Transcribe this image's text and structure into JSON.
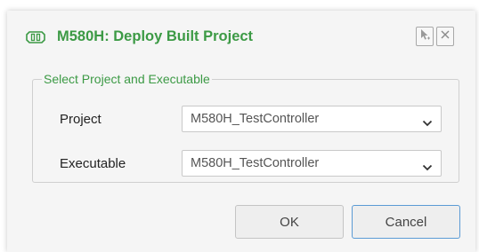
{
  "dialog": {
    "title": "M580H: Deploy Built Project",
    "icon": "controller-icon",
    "titlebar_buttons": [
      {
        "name": "pointer-icon"
      },
      {
        "name": "close-icon"
      }
    ]
  },
  "group": {
    "legend": "Select Project and Executable",
    "project": {
      "label": "Project",
      "value": "M580H_TestController"
    },
    "executable": {
      "label": "Executable",
      "value": "M580H_TestController"
    }
  },
  "buttons": {
    "ok": "OK",
    "cancel": "Cancel"
  },
  "colors": {
    "accent_green": "#3c9a45",
    "focus_blue": "#5b9bd5"
  }
}
